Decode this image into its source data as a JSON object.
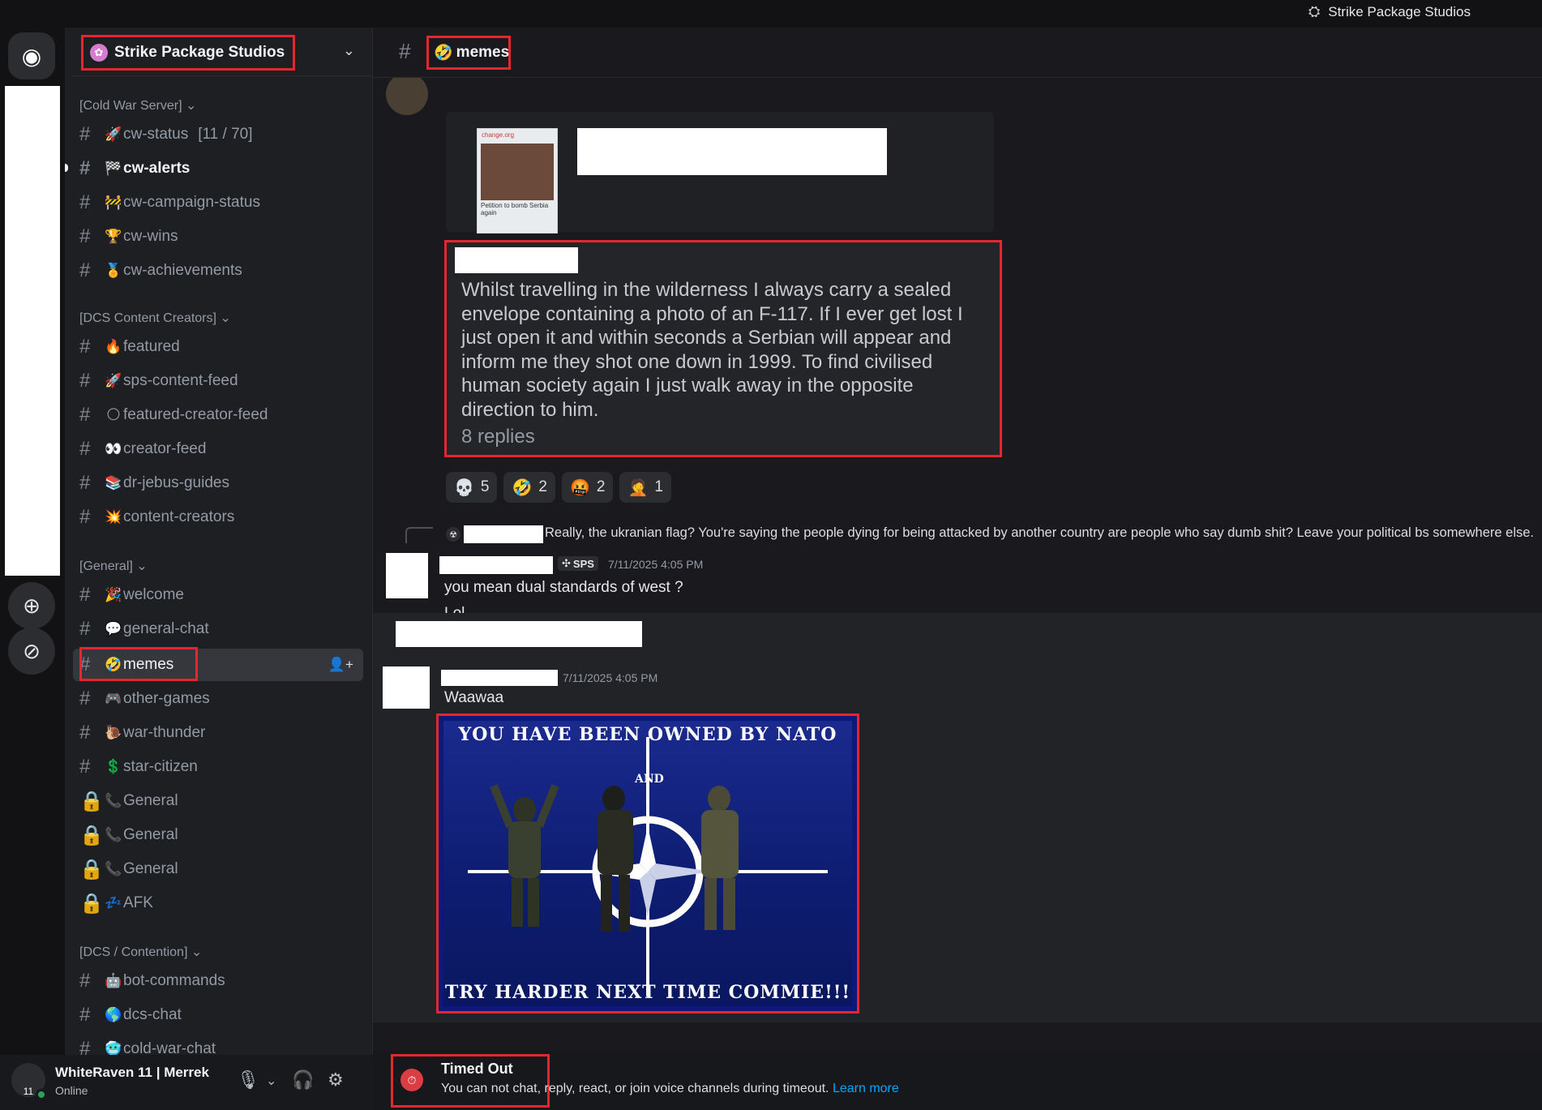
{
  "titlebar": {
    "app_title": "Strike Package Studios"
  },
  "server": {
    "name": "Strike Package Studios"
  },
  "categories": {
    "cold_war": "[Cold War Server] ⌄",
    "dcs_creators": "[DCS Content Creators] ⌄",
    "general": "[General] ⌄",
    "dcs_contention": "[DCS / Contention] ⌄"
  },
  "channels": {
    "cw_status": {
      "emoji": "🚀",
      "name": "cw-status",
      "suffix": "[11 / 70]"
    },
    "cw_alerts": {
      "emoji": "🏁",
      "name": "cw-alerts"
    },
    "cw_campaign_status": {
      "emoji": "🚧",
      "name": "cw-campaign-status"
    },
    "cw_wins": {
      "emoji": "🏆",
      "name": "cw-wins"
    },
    "cw_achievements": {
      "emoji": "🏅",
      "name": "cw-achievements"
    },
    "featured": {
      "emoji": "🔥",
      "name": "featured"
    },
    "sps_content_feed": {
      "emoji": "🚀",
      "name": "sps-content-feed"
    },
    "featured_creator_feed": {
      "emoji": "🌕",
      "name": "featured-creator-feed"
    },
    "creator_feed": {
      "emoji": "👀",
      "name": "creator-feed"
    },
    "dr_jebus_guides": {
      "emoji": "📚",
      "name": "dr-jebus-guides"
    },
    "content_creators": {
      "emoji": "💥",
      "name": "content-creators"
    },
    "welcome": {
      "emoji": "🎉",
      "name": "welcome"
    },
    "general_chat": {
      "emoji": "💬",
      "name": "general-chat"
    },
    "memes": {
      "emoji": "🤣",
      "name": "memes"
    },
    "other_games": {
      "emoji": "🎮",
      "name": "other-games"
    },
    "war_thunder": {
      "emoji": "🐌",
      "name": "war-thunder"
    },
    "star_citizen": {
      "emoji": "💲",
      "name": "star-citizen"
    },
    "voice_general_1": {
      "emoji": "📞",
      "name": "General"
    },
    "voice_general_2": {
      "emoji": "📞",
      "name": "General"
    },
    "voice_general_3": {
      "emoji": "📞",
      "name": "General"
    },
    "afk": {
      "emoji": "💤",
      "name": "AFK"
    },
    "bot_commands": {
      "emoji": "🤖",
      "name": "bot-commands"
    },
    "dcs_chat": {
      "emoji": "🌎",
      "name": "dcs-chat"
    },
    "cold_war_chat": {
      "emoji": "🥶",
      "name": "cold-war-chat"
    }
  },
  "user_panel": {
    "name": "WhiteRaven 11 | Merrek",
    "status": "Online",
    "avatar_text": "11"
  },
  "channel_header": {
    "emoji": "🤣",
    "name": "memes"
  },
  "embed": {
    "thumb_site": "change.org",
    "thumb_caption": "Petition to bomb Serbia again"
  },
  "quote": {
    "text": "Whilst travelling in the wilderness I always carry a sealed envelope containing a photo of an F-117. If I ever get lost I just open it and within seconds a Serbian will appear and inform me they shot one down in 1999. To find civilised human society again I just walk away in the opposite direction to him.",
    "replies": "8 replies"
  },
  "reactions": [
    {
      "emoji": "💀",
      "count": "5"
    },
    {
      "emoji": "🤣",
      "count": "2"
    },
    {
      "emoji": "🤬",
      "count": "2"
    },
    {
      "emoji": "🤦",
      "count": "1"
    }
  ],
  "reply_preview": "Really, the ukranian flag? You're saying the people dying for being attacked by another country are people who say dumb shit? Leave your political bs somewhere else.",
  "message1": {
    "tag": "SPS",
    "timestamp": "7/11/2025 4:05 PM",
    "lines": [
      "you mean dual standards of west ?",
      "Lol"
    ]
  },
  "message2": {
    "timestamp": "7/11/2025 4:05 PM",
    "text": "Waawaa"
  },
  "meme": {
    "top": "YOU HAVE BEEN OWNED BY NATO",
    "and": "AND",
    "bottom": "TRY HARDER NEXT TIME COMMIE!!!"
  },
  "timeout": {
    "title": "Timed Out",
    "body": "You can not chat, reply, react, or join voice channels during timeout.",
    "link": "Learn more"
  },
  "colors": {
    "accent_red": "#e5262f",
    "link": "#00a8fc",
    "online": "#23a55a"
  }
}
